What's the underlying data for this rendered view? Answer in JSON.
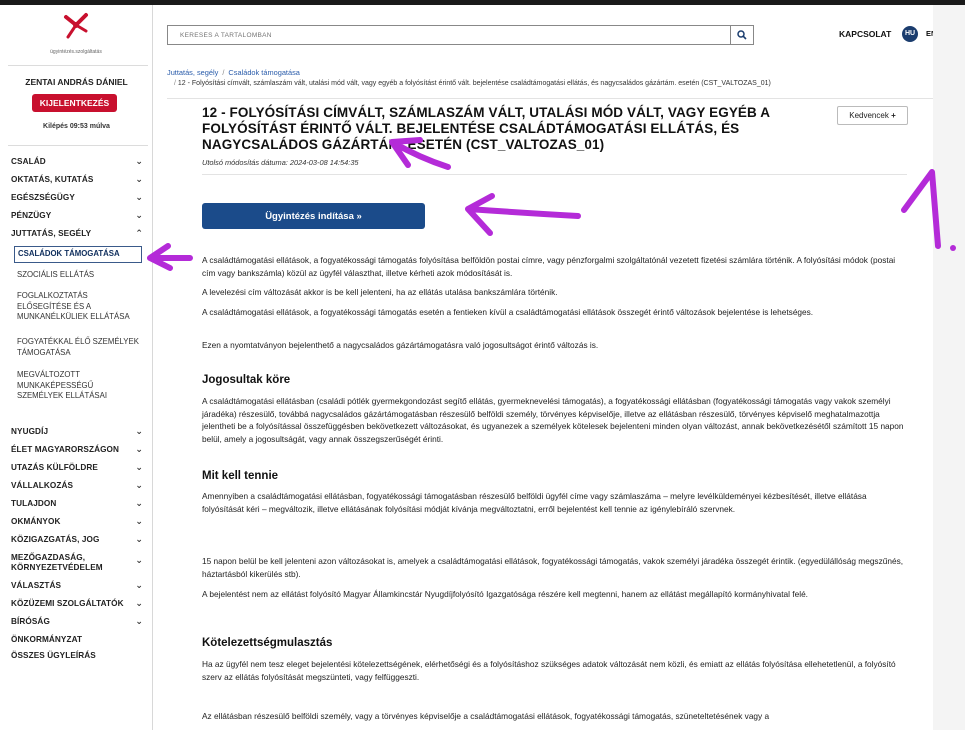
{
  "sidebar": {
    "logo_text": "ügyintézés.szolgáltatás",
    "user_name": "ZENTAI ANDRÁS DÁNIEL",
    "logout_label": "KIJELENTKEZÉS",
    "logout_time": "Kilépés 09:53 múlva",
    "items": [
      {
        "label": "CSALÁD",
        "chevron": "⌄"
      },
      {
        "label": "OKTATÁS, KUTATÁS",
        "chevron": "⌄"
      },
      {
        "label": "EGÉSZSÉGÜGY",
        "chevron": "⌄"
      },
      {
        "label": "PÉNZÜGY",
        "chevron": "⌄"
      },
      {
        "label": "JUTTATÁS, SEGÉLY",
        "chevron": "⌃"
      },
      {
        "label": "NYUGDÍJ",
        "chevron": "⌄"
      },
      {
        "label": "ÉLET MAGYARORSZÁGON",
        "chevron": "⌄"
      },
      {
        "label": "UTAZÁS KÜLFÖLDRE",
        "chevron": "⌄"
      },
      {
        "label": "VÁLLALKOZÁS",
        "chevron": "⌄"
      },
      {
        "label": "TULAJDON",
        "chevron": "⌄"
      },
      {
        "label": "OKMÁNYOK",
        "chevron": "⌄"
      },
      {
        "label": "KÖZIGAZGATÁS, JOG",
        "chevron": "⌄"
      },
      {
        "label": "MEZŐGAZDASÁG, KÖRNYEZETVÉDELEM",
        "chevron": "⌄"
      },
      {
        "label": "VÁLASZTÁS",
        "chevron": "⌄"
      },
      {
        "label": "KÖZÜZEMI SZOLGÁLTATÓK",
        "chevron": "⌄"
      },
      {
        "label": "BÍRÓSÁG",
        "chevron": "⌄"
      },
      {
        "label": "ÖNKORMÁNYZAT",
        "chevron": ""
      },
      {
        "label": "ÖSSZES ÜGYLEÍRÁS",
        "chevron": ""
      }
    ],
    "sub_items": [
      {
        "label": "CSALÁDOK TÁMOGATÁSA"
      },
      {
        "label": "SZOCIÁLIS ELLÁTÁS"
      },
      {
        "label": "FOGLALKOZTATÁS ELŐSEGÍTÉSE ÉS A MUNKANÉLKÜLIEK ELLÁTÁSA"
      },
      {
        "label": "FOGYATÉKKAL ÉLŐ SZEMÉLYEK TÁMOGATÁSA"
      },
      {
        "label": "MEGVÁLTOZOTT MUNKAKÉPESSÉGŰ SZEMÉLYEK ELLÁTÁSAI"
      }
    ]
  },
  "header": {
    "search_placeholder": "KERESÉS A TARTALOMBAN",
    "search_icon": "🔍",
    "contact_label": "KAPCSOLAT",
    "lang_active": "HU",
    "lang_other": "EN"
  },
  "breadcrumb": {
    "items": [
      "Juttatás, segély",
      "Családok támogatása"
    ],
    "current": "12 - Folyósítási címvált, számlaszám vált, utalási mód vált, vagy egyéb a folyósítást érintő vált. bejelentése családtámogatási ellátás, és nagycsaládos gázártám. esetén (CST_VALTOZAS_01)"
  },
  "page": {
    "title": "12 - FOLYÓSÍTÁSI CÍMVÁLT, SZÁMLASZÁM VÁLT, UTALÁSI MÓD VÁLT, VAGY EGYÉB A FOLYÓSÍTÁST ÉRINTŐ VÁLT. BEJELENTÉSE CSALÁDTÁMOGATÁSI ELLÁTÁS, ÉS NAGYCSALÁDOS GÁZÁRTÁM. ESETÉN (CST_VALTOZAS_01)",
    "favorites_label": "Kedvencek",
    "favorites_icon": "+",
    "updated": "Utolsó módosítás dátuma: 2024-03-08 14:54:35",
    "start_button": "Ügyintézés indítása »",
    "intro": [
      "A családtámogatási ellátások, a fogyatékossági támogatás folyósítása belföldön postai címre, vagy pénzforgalmi szolgáltatónál vezetett fizetési számlára történik. A folyósítási módok (postai cím vagy bankszámla) közül az ügyfél választhat, illetve kérheti azok módosítását is.",
      "A levelezési cím változását akkor is be kell jelenteni, ha az ellátás utalása bankszámlára történik.",
      "A családtámogatási ellátások, a fogyatékossági támogatás esetén a fentieken kívül a családtámogatási ellátások összegét érintő változások bejelentése is lehetséges.",
      "Ezen a nyomtatványon bejelenthető a nagycsaládos gázártámogatásra való jogosultságot érintő változás is."
    ],
    "section1_title": "Jogosultak köre",
    "section1_text": "A családtámogatási ellátásban (családi pótlék gyermekgondozást segítő ellátás, gyermeknevelési támogatás), a fogyatékossági ellátásban (fogyatékossági támogatás vagy vakok személyi járadéka) részesülő, továbbá nagycsaládos gázártámogatásban részesülő belföldi személy, törvényes képviselője, illetve az ellátásban részesülő, törvényes képviselő meghatalmazottja jelentheti be a folyósítással összefüggésben bekövetkezett változásokat, és ugyanezek a személyek kötelesek bejelenteni minden olyan változást, annak bekövetkezésétől számított 15 napon belül, amely a jogosultságát, vagy annak összegszerűségét érinti.",
    "section2_title": "Mit kell tennie",
    "section2_texts": [
      "Amennyiben a családtámogatási ellátásban, fogyatékossági támogatásban részesülő belföldi ügyfél címe vagy számlaszáma – melyre levélküldeményei kézbesítését, illetve ellátása folyósítását kéri – megváltozik, illetve ellátásának folyósítási módját kívánja megváltoztatni, erről bejelentést kell tennie az igénylebíráló szervnek.",
      "15 napon belül be kell jelenteni azon változásokat is, amelyek a családtámogatási ellátások, fogyatékossági támogatás, vakok személyi járadéka összegét érintik. (egyedülállóság megszűnés, háztartásból kikerülés stb).",
      "A bejelentést nem az ellátást folyósító Magyar Államkincstár Nyugdíjfolyósító Igazgatósága részére kell megtenni, hanem az ellátást megállapító kormányhivatal felé."
    ],
    "section3_title": "Kötelezettségmulasztás",
    "section3_texts": [
      "Ha az ügyfél nem tesz eleget bejelentési kötelezettségének, elérhetőségi és a folyósításhoz szükséges adatok változását nem közli, és emiatt az ellátás folyósítása ellehetetlenül, a folyósító szerv az ellátás folyósítását megszünteti, vagy felfüggeszti.",
      "Az ellátásban részesülő belföldi személy, vagy a törvényes képviselője a családtámogatási ellátások, fogyatékossági támogatás, szüneteltetésének vagy a"
    ]
  },
  "annotation": {
    "label": "1.",
    "color": "#b42bd8"
  }
}
